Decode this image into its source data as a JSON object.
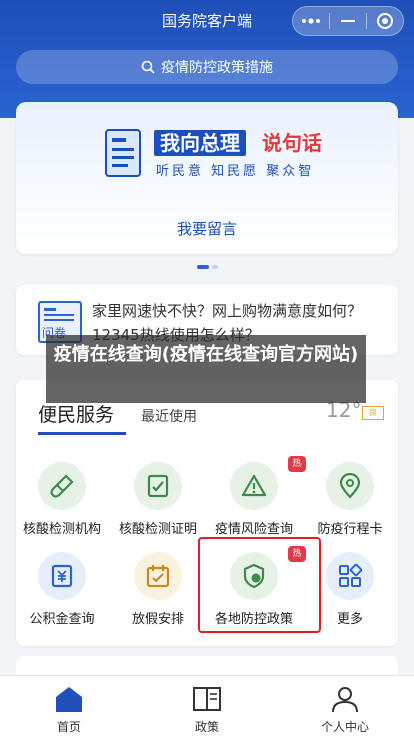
{
  "app": {
    "title": "国务院客户端"
  },
  "search": {
    "placeholder": "疫情防控政策措施"
  },
  "banner": {
    "title_a": "我向总理",
    "title_b": "说句话",
    "subtitle": "听民意 知民愿 聚众智",
    "cta": "我要留言"
  },
  "notice": {
    "text": "家里网速快不快？网上购物满意度如何？12345热线使用怎么样？"
  },
  "overlay": {
    "text": "疫情在线查询(疫情在线查询官方网站)"
  },
  "services": {
    "tab_main": "便民服务",
    "tab_recent": "最近使用",
    "weather": "12°",
    "aqi": "良",
    "items": [
      {
        "label": "核酸检测机构"
      },
      {
        "label": "核酸检测证明"
      },
      {
        "label": "疫情风险查询",
        "badge": "热"
      },
      {
        "label": "防疫行程卡"
      },
      {
        "label": "公积金查询"
      },
      {
        "label": "放假安排"
      },
      {
        "label": "各地防控政策",
        "badge": "热"
      },
      {
        "label": "更多"
      }
    ]
  },
  "tabbar": [
    {
      "label": "首页",
      "active": true
    },
    {
      "label": "政策"
    },
    {
      "label": "个人中心"
    }
  ],
  "colors": {
    "primary": "#1f4fb8",
    "hot": "#e03b4a",
    "icon_green": "#3d8b4a",
    "icon_blue": "#2a63d2",
    "icon_orange": "#c98a1b"
  }
}
